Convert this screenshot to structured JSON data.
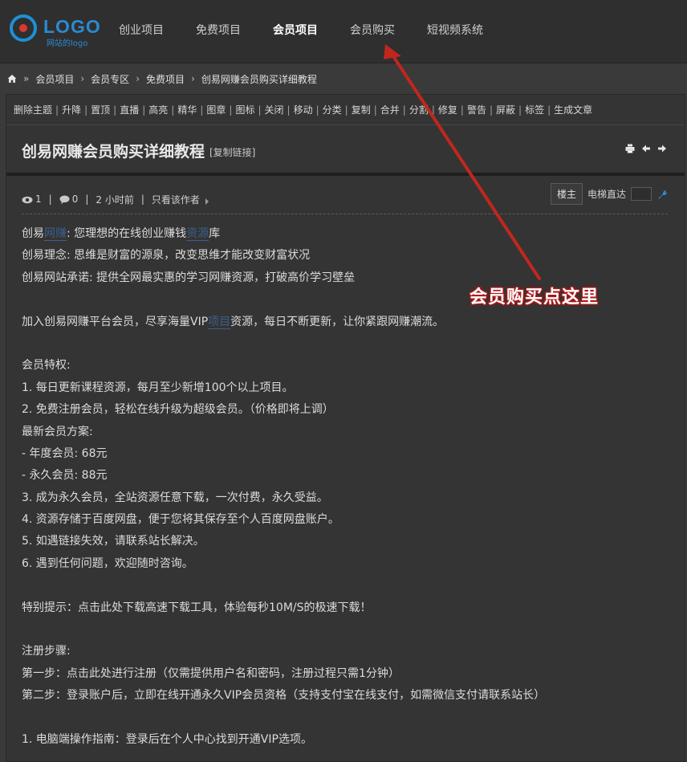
{
  "logo": {
    "text": "LOGO",
    "subtitle": "网站的logo"
  },
  "nav": [
    {
      "label": "创业项目"
    },
    {
      "label": "免费项目"
    },
    {
      "label": "会员项目",
      "active": true
    },
    {
      "label": "会员购买"
    },
    {
      "label": "短视频系统"
    }
  ],
  "breadcrumb": {
    "separator": "»",
    "items": [
      "会员项目",
      "会员专区",
      "免费项目",
      "创易网赚会员购买详细教程"
    ],
    "chevron": "›"
  },
  "toolbar": [
    "删除主题",
    "升降",
    "置顶",
    "直播",
    "高亮",
    "精华",
    "图章",
    "图标",
    "关闭",
    "移动",
    "分类",
    "复制",
    "合并",
    "分割",
    "修复",
    "警告",
    "屏蔽",
    "标签",
    "生成文章"
  ],
  "post": {
    "title": "创易网赚会员购买详细教程",
    "copy_link": "[复制链接]"
  },
  "meta": {
    "views": "1",
    "comments": "0",
    "time": "2 小时前",
    "author_only": "只看该作者",
    "floor_button": "楼主",
    "elevator_label": "电梯直达"
  },
  "content": {
    "l1_a": "创易",
    "l1_kw1": "网赚",
    "l1_b": ": 您理想的在线创业赚钱",
    "l1_kw2": "资源",
    "l1_c": "库",
    "l2": "创易理念: 思维是财富的源泉，改变思维才能改变财富状况",
    "l3": "创易网站承诺: 提供全网最实惠的学习网赚资源，打破高价学习壁垒",
    "l4_a": "加入创易网赚平台会员，尽享海量VIP",
    "l4_kw": "项目",
    "l4_b": "资源，每日不断更新，让你紧跟网赚潮流。",
    "l5": "会员特权:",
    "l6": "1. 每日更新课程资源，每月至少新增100个以上项目。",
    "l7": "2. 免费注册会员，轻松在线升级为超级会员。（价格即将上调）",
    "l8": "最新会员方案:",
    "l9": "- 年度会员: 68元",
    "l10": "- 永久会员: 88元",
    "l11": "3. 成为永久会员，全站资源任意下载，一次付费，永久受益。",
    "l12": "4. 资源存储于百度网盘，便于您将其保存至个人百度网盘账户。",
    "l13": "5. 如遇链接失效，请联系站长解决。",
    "l14": "6. 遇到任何问题，欢迎随时咨询。",
    "l15": "特别提示：点击此处下载高速下载工具，体验每秒10M/S的极速下载！",
    "l16": "注册步骤:",
    "l17": "第一步：点击此处进行注册（仅需提供用户名和密码，注册过程只需1分钟）",
    "l18": "第二步：登录账户后，立即在线开通永久VIP会员资格（支持支付宝在线支付，如需微信支付请联系站长）",
    "l19": "1. 电脑端操作指南：登录后在个人中心找到开通VIP选项。"
  },
  "annotation": {
    "text": "会员购买点这里",
    "color": "#c0271d"
  }
}
